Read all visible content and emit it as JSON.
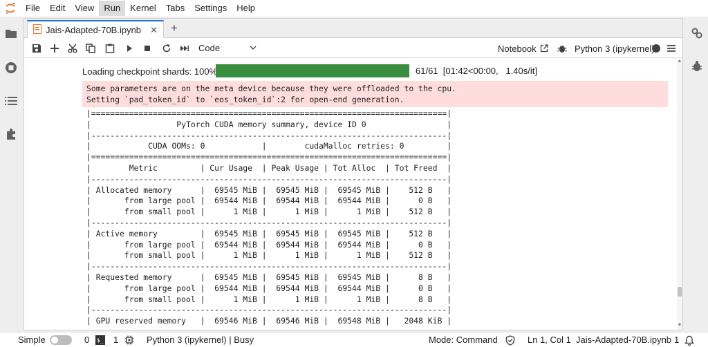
{
  "menubar": {
    "items": [
      "File",
      "Edit",
      "View",
      "Run",
      "Kernel",
      "Tabs",
      "Settings",
      "Help"
    ],
    "active": "Run"
  },
  "colors": {
    "accent": "#1976d2",
    "progress": "#388e3c",
    "stderr_bg": "#ffdddd",
    "jupyter_orange": "#f37726"
  },
  "sidebar_left": [
    "folder-icon",
    "running-icon",
    "toc-icon",
    "extension-icon"
  ],
  "sidebar_right": [
    "property-inspector-icon",
    "debugger-icon"
  ],
  "tab": {
    "title": "Jais-Adapted-70B.ipynb"
  },
  "toolbar": {
    "cell_type": "Code",
    "notebook_label": "Notebook",
    "kernel_label": "Python 3 (ipykernel)"
  },
  "output": {
    "progress": {
      "label": "Loading checkpoint shards: 100%",
      "fraction": 1.0,
      "stats": "61/61  [01:42<00:00,   1.40s/it]"
    },
    "stderr": [
      "Some parameters are on the meta device because they were offloaded to the cpu.",
      "Setting `pad_token_id` to `eos_token_id`:2 for open-end generation."
    ],
    "memory_table": [
      "|===========================================================================|",
      "|                  PyTorch CUDA memory summary, device ID 0                 |",
      "|---------------------------------------------------------------------------|",
      "|            CUDA OOMs: 0            |        cudaMalloc retries: 0         |",
      "|===========================================================================|",
      "|        Metric         | Cur Usage  | Peak Usage | Tot Alloc  | Tot Freed  |",
      "|---------------------------------------------------------------------------|",
      "| Allocated memory      |  69545 MiB |  69545 MiB |  69545 MiB |    512 B   |",
      "|       from large pool |  69544 MiB |  69544 MiB |  69544 MiB |      0 B   |",
      "|       from small pool |      1 MiB |      1 MiB |      1 MiB |    512 B   |",
      "|---------------------------------------------------------------------------|",
      "| Active memory         |  69545 MiB |  69545 MiB |  69545 MiB |    512 B   |",
      "|       from large pool |  69544 MiB |  69544 MiB |  69544 MiB |      0 B   |",
      "|       from small pool |      1 MiB |      1 MiB |      1 MiB |    512 B   |",
      "|---------------------------------------------------------------------------|",
      "| Requested memory      |  69545 MiB |  69545 MiB |  69545 MiB |      8 B   |",
      "|       from large pool |  69544 MiB |  69544 MiB |  69544 MiB |      0 B   |",
      "|       from small pool |      1 MiB |      1 MiB |      1 MiB |      8 B   |",
      "|---------------------------------------------------------------------------|",
      "| GPU reserved memory   |  69546 MiB |  69546 MiB |  69548 MiB |   2048 KiB |"
    ]
  },
  "statusbar": {
    "mode_label": "Simple",
    "terminals": "0",
    "kernels": "1",
    "kernel_status": "Python 3 (ipykernel) | Busy",
    "mode": "Mode: Command",
    "position": "Ln 1, Col 1",
    "filename": "Jais-Adapted-70B.ipynb",
    "notifications": "1"
  }
}
